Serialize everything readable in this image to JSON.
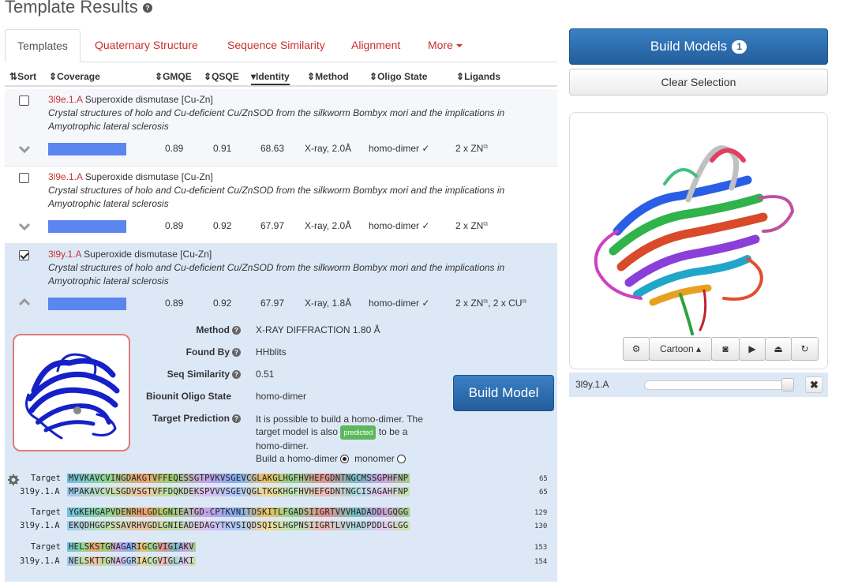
{
  "page": {
    "title": "Template Results"
  },
  "tabs": [
    {
      "label": "Templates"
    },
    {
      "label": "Quaternary Structure"
    },
    {
      "label": "Sequence Similarity"
    },
    {
      "label": "Alignment"
    },
    {
      "label": "More"
    }
  ],
  "columns": {
    "sort": "Sort",
    "coverage": "Coverage",
    "gmqe": "GMQE",
    "qsqe": "QSQE",
    "identity": "Identity",
    "method": "Method",
    "oligo": "Oligo State",
    "ligands": "Ligands"
  },
  "rows": [
    {
      "id": "3l9e.1.A",
      "name": "Superoxide dismutase [Cu-Zn]",
      "desc": "Crystal structures of holo and Cu-deficient Cu/ZnSOD from the silkworm Bombyx mori and the implications in Amyotrophic lateral sclerosis",
      "coverage": 1.0,
      "gmqe": "0.89",
      "qsqe": "0.91",
      "identity": "68.63",
      "method": "X-ray, 2.0Å",
      "oligo": "homo-dimer ✓",
      "ligands": "2 x ZN",
      "checked": false
    },
    {
      "id": "3l9e.1.A",
      "name": "Superoxide dismutase [Cu-Zn]",
      "desc": "Crystal structures of holo and Cu-deficient Cu/ZnSOD from the silkworm Bombyx mori and the implications in Amyotrophic lateral sclerosis",
      "coverage": 1.0,
      "gmqe": "0.89",
      "qsqe": "0.92",
      "identity": "67.97",
      "method": "X-ray, 2.0Å",
      "oligo": "homo-dimer ✓",
      "ligands": "2 x ZN",
      "checked": false
    },
    {
      "id": "3l9y.1.A",
      "name": "Superoxide dismutase [Cu-Zn]",
      "desc": "Crystal structures of holo and Cu-deficient Cu/ZnSOD from the silkworm Bombyx mori and the implications in Amyotrophic lateral sclerosis",
      "coverage": 1.0,
      "gmqe": "0.89",
      "qsqe": "0.92",
      "identity": "67.97",
      "method": "X-ray, 1.8Å",
      "oligo": "homo-dimer ✓",
      "ligands": "2 x ZN",
      "ligands2": "2 x CU",
      "checked": true
    }
  ],
  "detail": {
    "method_label": "Method",
    "method": "X-RAY DIFFRACTION 1.80 Å",
    "found_label": "Found By",
    "found": "HHblits",
    "sim_label": "Seq Similarity",
    "sim": "0.51",
    "oligo_label": "Biounit Oligo State",
    "oligo": "homo-dimer",
    "pred_label": "Target Prediction",
    "pred_line1": "It is possible to build a homo-dimer. The",
    "pred_line2a": "target model is also",
    "pred_badge": "predicted",
    "pred_line2b": "to be a",
    "pred_line3": "homo-dimer.",
    "build_as": "Build a homo-dimer",
    "monomer": "monomer",
    "build_button": "Build Model"
  },
  "alignment": [
    {
      "target_label": "Target",
      "target": "MVVKAVCVINGDAKGTVFFEQESSGTPVKVSGEVCGLAKGLHGFHVHEFGDNTNGCMSSGPHFNP",
      "target_end": "65",
      "tmpl_label": "3l9y.1.A",
      "tmpl": "MPAKAVCVLSGDVSGTVFFDQKDEKSPVVVSGEVQGLTKGKHGFHVHEFGDNTNGCISAGAHFNP",
      "tmpl_end": "65"
    },
    {
      "target_label": "Target",
      "target": "YGKEHGAPVDENRHLGDLGNIEATGD-CPTKVNITDSKITLFGADSIIGRTVVVHADADDLGQGG",
      "target_end": "129",
      "tmpl_label": "3l9y.1.A",
      "tmpl": "EKQDHGGPSSAVRHVGDLGNIEADEDAGYTKVSIQDSQISLHGPNSIIGRTLVVHADPDDLGLGG",
      "tmpl_end": "130"
    },
    {
      "target_label": "Target",
      "target": "HELSKSTGNAGARIGCGVIGIAKV",
      "target_end": "153",
      "tmpl_label": "3l9y.1.A",
      "tmpl": "NELSKTTGNAGGRIACGVIGLAKI",
      "tmpl_end": "154"
    }
  ],
  "right": {
    "build_models": "Build Models",
    "count": "1",
    "clear": "Clear Selection",
    "cartoon": "Cartoon",
    "slider_label": "3l9y.1.A",
    "slider_value": 1.0
  }
}
